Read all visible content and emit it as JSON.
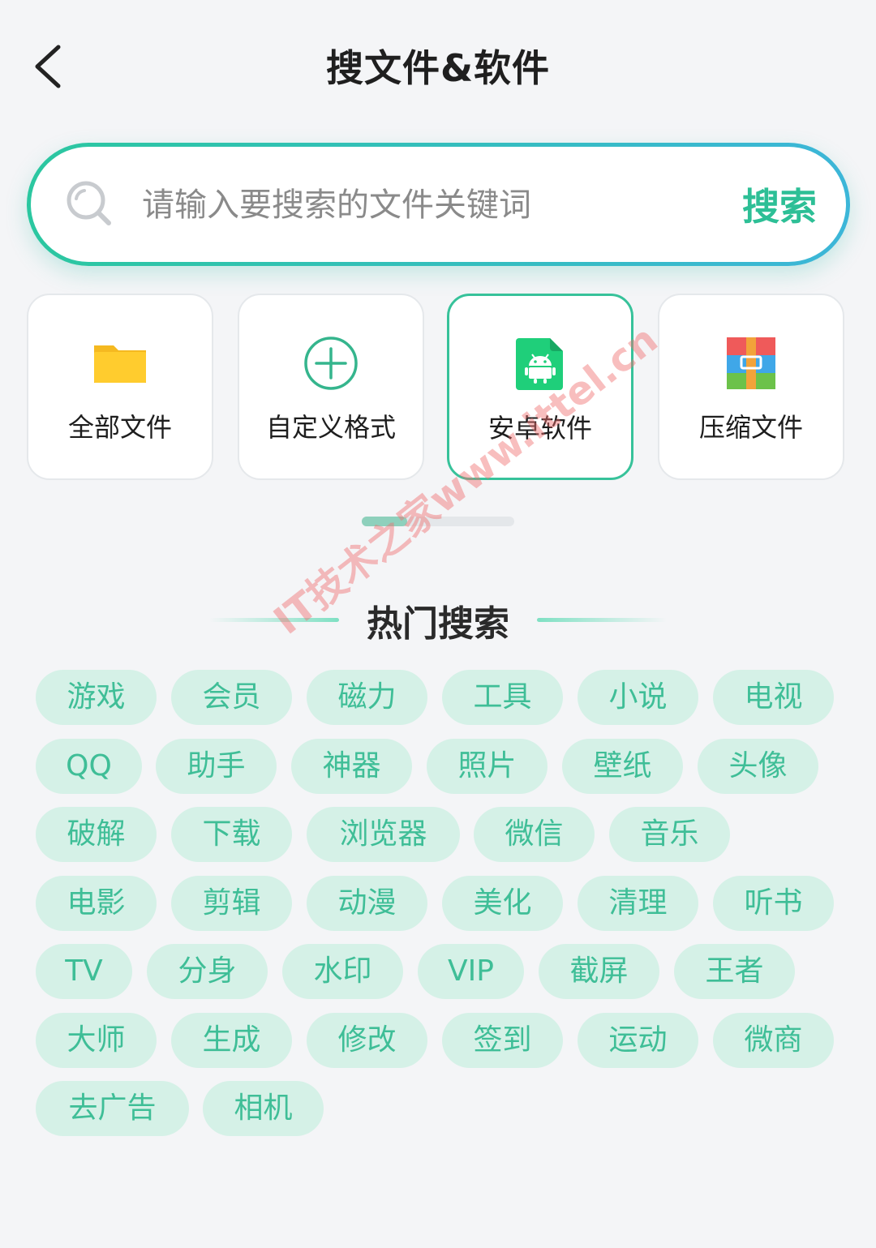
{
  "header": {
    "title": "搜文件&软件"
  },
  "search": {
    "placeholder": "请输入要搜索的文件关键词",
    "button_label": "搜索"
  },
  "categories": [
    {
      "label": "全部文件",
      "icon": "folder-icon"
    },
    {
      "label": "自定义格式",
      "icon": "plus-circle-icon"
    },
    {
      "label": "安卓软件",
      "icon": "android-file-icon",
      "selected": true
    },
    {
      "label": "压缩文件",
      "icon": "archive-icon"
    }
  ],
  "hot": {
    "title": "热门搜索",
    "rows": [
      [
        "游戏",
        "会员",
        "磁力",
        "工具",
        "小说",
        "电视"
      ],
      [
        "QQ",
        "助手",
        "神器",
        "照片",
        "壁纸",
        "头像"
      ],
      [
        "破解",
        "下载",
        "浏览器",
        "微信",
        "音乐"
      ],
      [
        "电影",
        "剪辑",
        "动漫",
        "美化",
        "清理",
        "听书"
      ],
      [
        "TV",
        "分身",
        "水印",
        "VIP",
        "截屏",
        "王者"
      ],
      [
        "大师",
        "生成",
        "修改",
        "签到",
        "运动",
        "微商"
      ],
      [
        "去广告",
        "相机"
      ]
    ]
  },
  "watermark": "IT技术之家www.ittel.cn",
  "colors": {
    "accent": "#2dbf96",
    "tag_bg": "#d5f1e7",
    "tag_text": "#3fbe97"
  }
}
